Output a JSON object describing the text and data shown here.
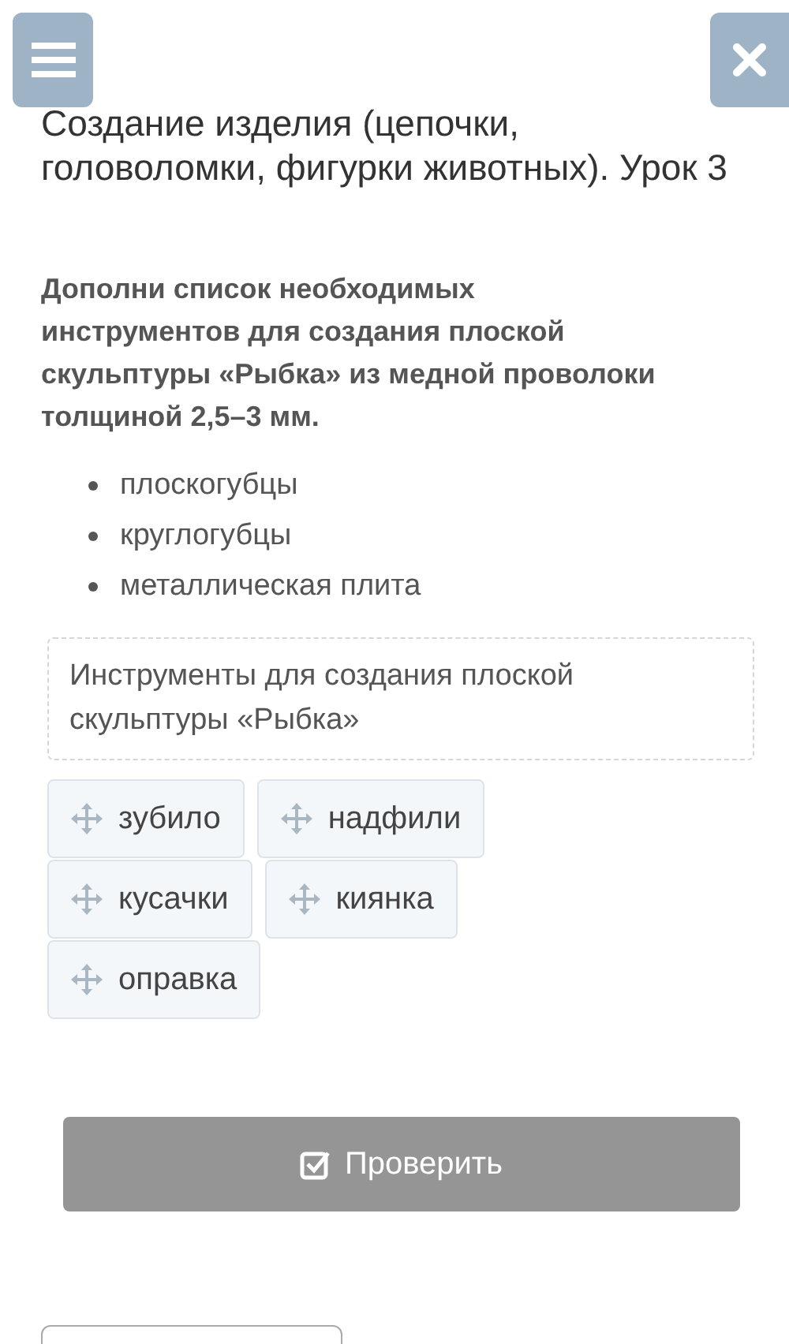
{
  "title": "Создание изделия (цепочки, головоломки, фигурки животных). Урок 3",
  "question": "Дополни список необходимых инструментов для создания плоской скульптуры «Рыбка» из медной проволоки толщиной 2,5–3 мм.",
  "list": [
    "плоскогубцы",
    "круглогубцы",
    "металлическая плита"
  ],
  "drop_zone": {
    "label": "Инструменты для создания плоской скульптуры «Рыбка»"
  },
  "options": [
    "зубило",
    "надфили",
    "кусачки",
    "киянка",
    "оправка"
  ],
  "check_button": {
    "label": "Проверить",
    "disabled": true
  }
}
